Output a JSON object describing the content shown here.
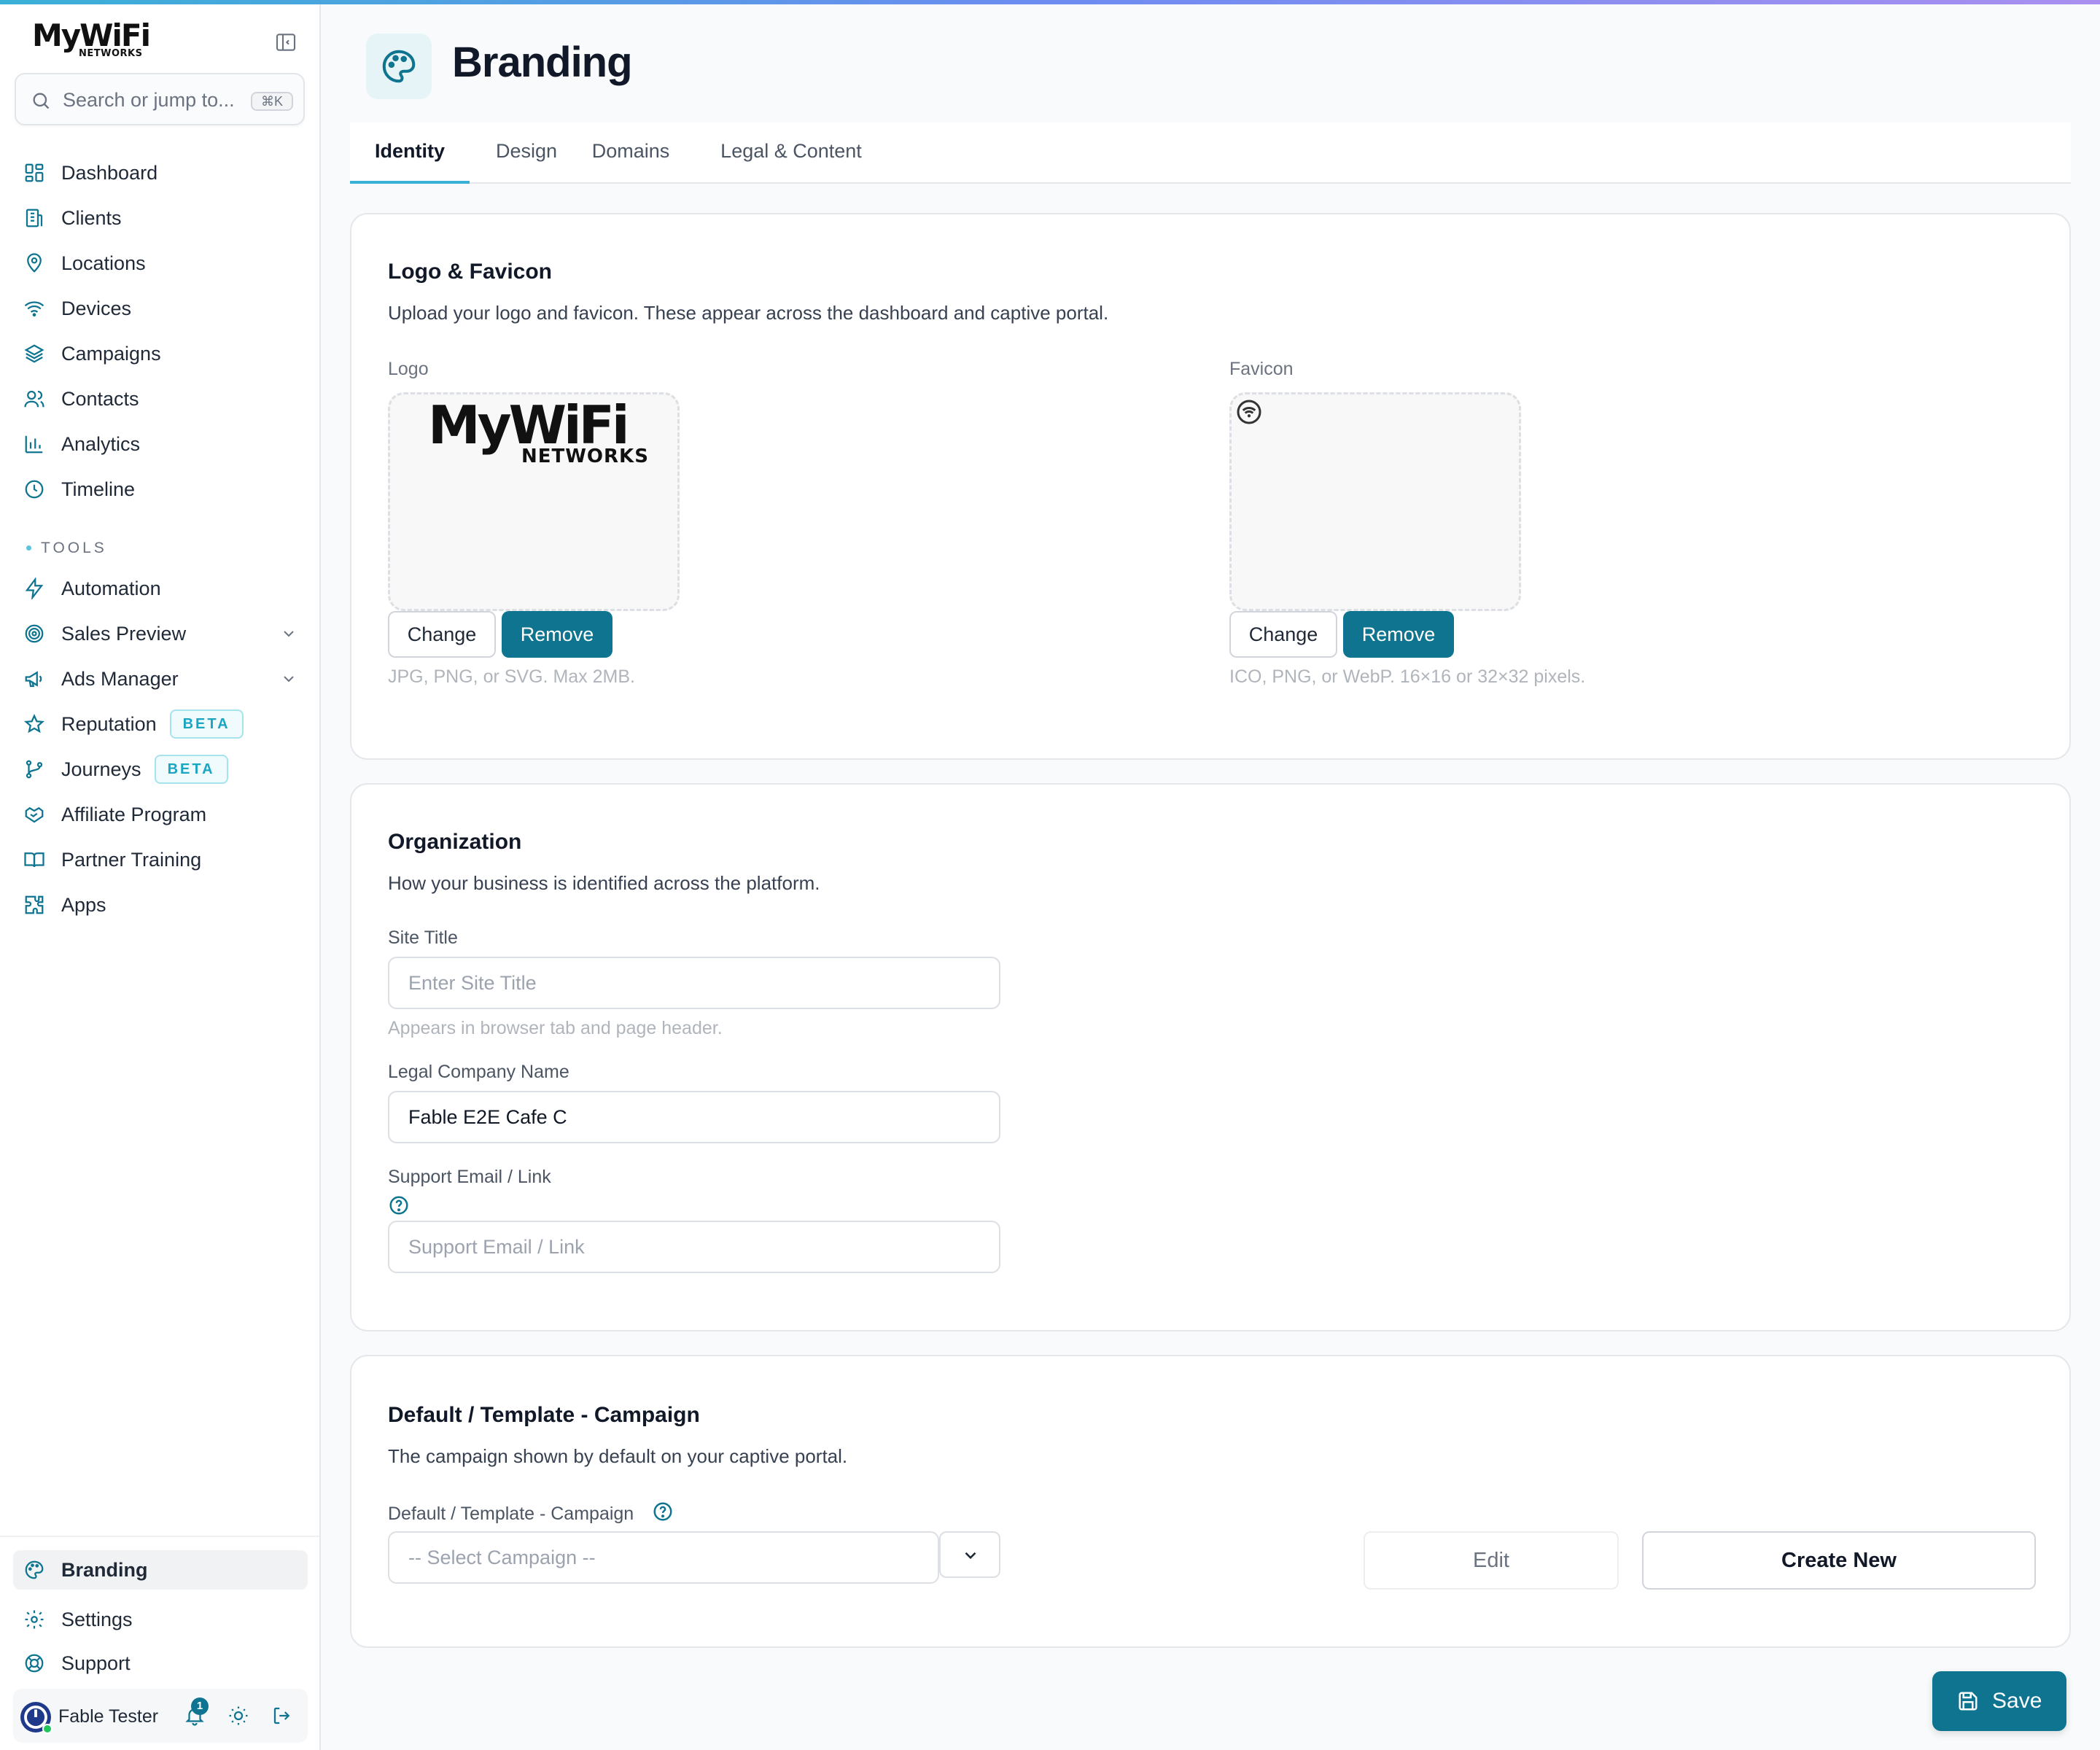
{
  "app": {
    "brand_line1": "MyWiFi",
    "brand_line2": "NETWORKS",
    "search_placeholder": "Search or jump to...",
    "search_shortcut": "⌘K"
  },
  "sidebar": {
    "main_items": [
      {
        "label": "Dashboard",
        "icon": "dashboard-icon"
      },
      {
        "label": "Clients",
        "icon": "building-icon"
      },
      {
        "label": "Locations",
        "icon": "map-pin-icon"
      },
      {
        "label": "Devices",
        "icon": "wifi-icon"
      },
      {
        "label": "Campaigns",
        "icon": "layers-icon"
      },
      {
        "label": "Contacts",
        "icon": "users-icon"
      },
      {
        "label": "Analytics",
        "icon": "bar-chart-icon"
      },
      {
        "label": "Timeline",
        "icon": "clock-icon"
      }
    ],
    "tools_label": "TOOLS",
    "tool_items": [
      {
        "label": "Automation",
        "icon": "lightning-icon"
      },
      {
        "label": "Sales Preview",
        "icon": "target-icon"
      },
      {
        "label": "Ads Manager",
        "icon": "megaphone-icon"
      },
      {
        "label": "Reputation",
        "icon": "star-icon",
        "badge": "BETA"
      },
      {
        "label": "Journeys",
        "icon": "branch-icon",
        "badge": "BETA"
      },
      {
        "label": "Affiliate Program",
        "icon": "handshake-icon"
      },
      {
        "label": "Partner Training",
        "icon": "book-icon"
      },
      {
        "label": "Apps",
        "icon": "puzzle-icon"
      }
    ],
    "bottom_items": [
      {
        "label": "Branding",
        "icon": "palette-icon"
      },
      {
        "label": "Settings",
        "icon": "gear-icon"
      },
      {
        "label": "Support",
        "icon": "lifebuoy-icon"
      }
    ],
    "user": {
      "name": "Fable Tester",
      "notifications": "1"
    }
  },
  "page": {
    "title": "Branding",
    "tabs": [
      "Identity",
      "Design",
      "Domains",
      "Legal & Content"
    ]
  },
  "logo_card": {
    "title": "Logo & Favicon",
    "description": "Upload your logo and favicon. These appear across the dashboard and captive portal.",
    "logo_label": "Logo",
    "favicon_label": "Favicon",
    "change_label": "Change",
    "remove_label": "Remove",
    "logo_hint": "JPG, PNG, or SVG. Max 2MB.",
    "favicon_hint": "ICO, PNG, or WebP. 16×16 or 32×32 pixels."
  },
  "org_card": {
    "title": "Organization",
    "description": "How your business is identified across the platform.",
    "site_title_label": "Site Title",
    "site_title_placeholder": "Enter Site Title",
    "site_title_hint": "Appears in browser tab and page header.",
    "legal_name_label": "Legal Company Name",
    "legal_name_value": "Fable E2E Cafe C",
    "support_label": "Support Email / Link",
    "support_placeholder": "Support Email / Link"
  },
  "campaign_card": {
    "title": "Default / Template - Campaign",
    "description": "The campaign shown by default on your captive portal.",
    "field_label": "Default / Template - Campaign",
    "select_placeholder": "-- Select Campaign --",
    "edit_label": "Edit",
    "create_label": "Create New"
  },
  "footer": {
    "save_label": "Save"
  },
  "colors": {
    "accent": "#0e7490",
    "tab_underline": "#3ab0d6",
    "beta": "#1aa5c2"
  }
}
